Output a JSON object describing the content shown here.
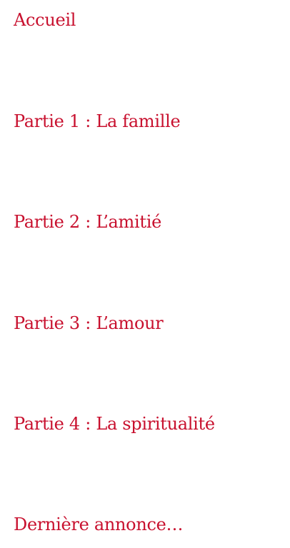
{
  "theme": {
    "link_color": "#c8102e",
    "background": "#ffffff"
  },
  "menu": {
    "items": [
      {
        "label": "Accueil"
      },
      {
        "label": "Partie 1 : La famille"
      },
      {
        "label": "Partie 2 : L’amitié"
      },
      {
        "label": "Partie 3 : L’amour"
      },
      {
        "label": "Partie 4 : La spiritualité"
      },
      {
        "label": "Dernière annonce…"
      }
    ]
  }
}
